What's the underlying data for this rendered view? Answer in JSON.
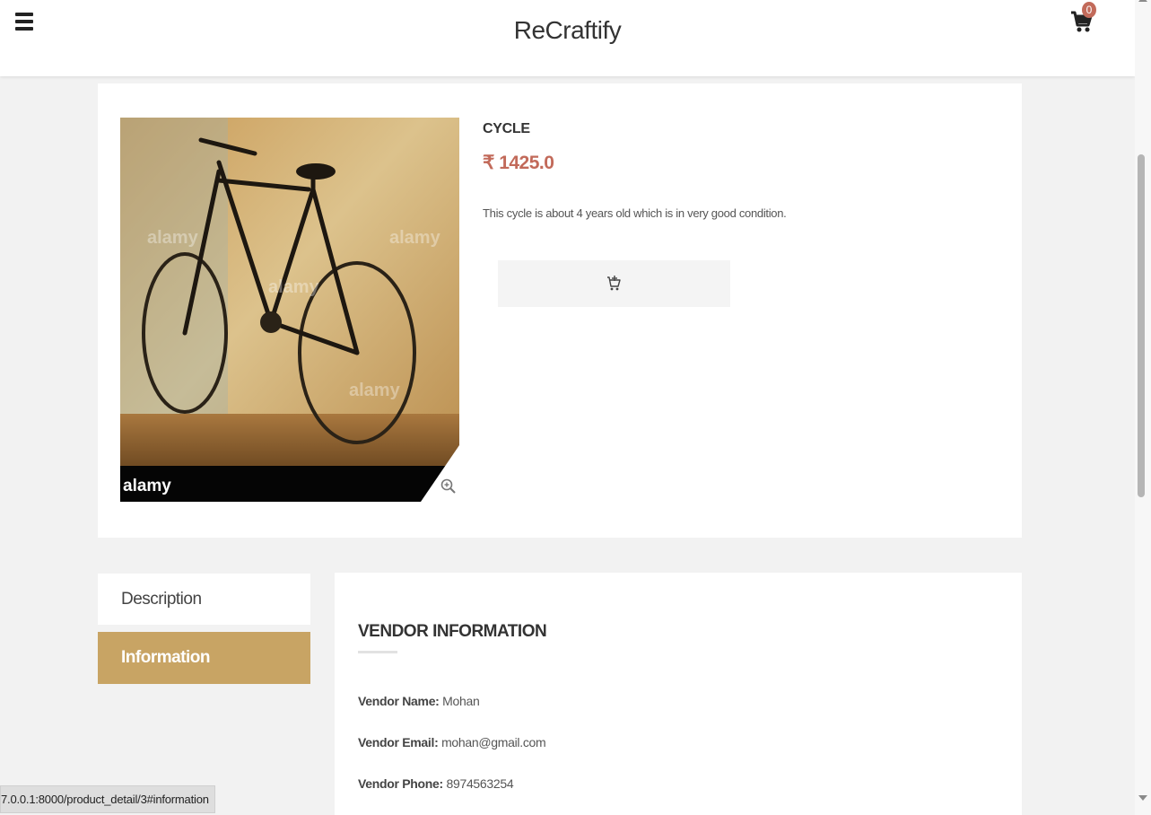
{
  "header": {
    "brand": "ReCraftify",
    "cart_count": "0"
  },
  "product": {
    "name": "CYCLE",
    "price": "₹ 1425.0",
    "description": "This cycle is about 4 years old which is in very good condition.",
    "image_watermark": "alamy"
  },
  "tabs": [
    {
      "label": "Description"
    },
    {
      "label": "Information"
    }
  ],
  "vendor": {
    "title": "VENDOR INFORMATION",
    "name_label": "Vendor Name:",
    "name_value": "Mohan",
    "email_label": "Vendor Email:",
    "email_value": "mohan@gmail.com",
    "phone_label": "Vendor Phone:",
    "phone_value": "8974563254"
  },
  "status_bar": {
    "url": "7.0.0.1:8000/product_detail/3#information"
  },
  "colors": {
    "accent": "#c8a464",
    "price": "#c26a5a",
    "badge": "#c26a5a"
  },
  "icons": [
    "hamburger-menu-icon",
    "shopping-cart-icon",
    "zoom-in-icon",
    "add-to-cart-icon"
  ]
}
